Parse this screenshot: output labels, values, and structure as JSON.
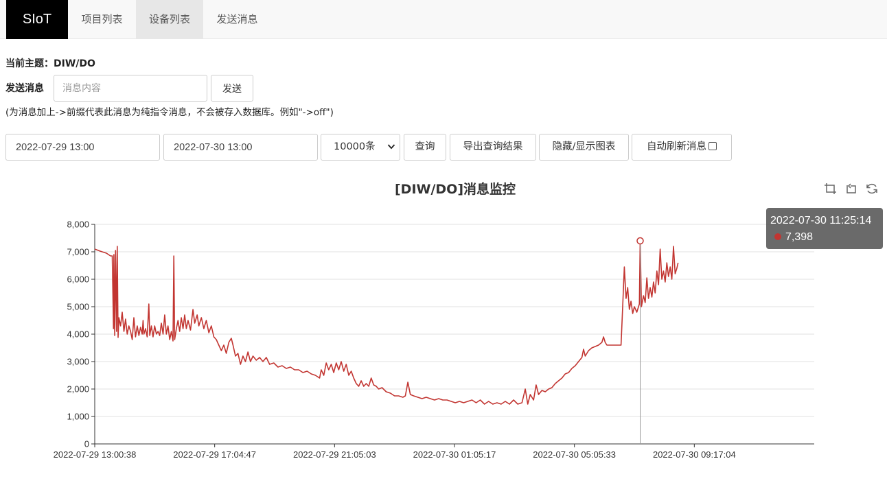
{
  "nav": {
    "brand": "SIoT",
    "items": [
      "项目列表",
      "设备列表",
      "发送消息"
    ]
  },
  "topic": {
    "label": "当前主题：DIW/DO"
  },
  "send": {
    "label": "发送消息",
    "placeholder": "消息内容",
    "button": "发送",
    "hint": "(为消息加上->前缀代表此消息为纯指令消息，不会被存入数据库。例如\"->off\")"
  },
  "query": {
    "start": "2022-07-29 13:00",
    "end": "2022-07-30 13:00",
    "limit": "10000条",
    "search_button": "查询",
    "export_button": "导出查询结果",
    "toggle_chart_button": "隐藏/显示图表",
    "auto_refresh_label": "自动刷新消息"
  },
  "colors": {
    "series": "#c23531",
    "brand_bg": "#000000",
    "tooltip_bg": "#505050"
  },
  "tooltip": {
    "time": "2022-07-30 11:25:14",
    "value": "7,398"
  },
  "toolbox": [
    "zoom-icon",
    "zoom-reset-icon",
    "restore-icon"
  ],
  "chart_data": {
    "type": "line",
    "title": "[DIW/DO]消息监控",
    "xlabel": "",
    "ylabel": "",
    "x_range": [
      0,
      86400
    ],
    "ylim": [
      0,
      8000
    ],
    "yticks": [
      0,
      1000,
      2000,
      3000,
      4000,
      5000,
      6000,
      7000,
      8000
    ],
    "ytick_labels": [
      "0",
      "1,000",
      "2,000",
      "3,000",
      "4,000",
      "5,000",
      "6,000",
      "7,000",
      "8,000"
    ],
    "xtick_labels": [
      {
        "t": 0,
        "label": "2022-07-29 13:00:38"
      },
      {
        "t": 14400,
        "label": "2022-07-29 17:04:47"
      },
      {
        "t": 28800,
        "label": "2022-07-29 21:05:03"
      },
      {
        "t": 43200,
        "label": "2022-07-30 01:05:17"
      },
      {
        "t": 57600,
        "label": "2022-07-30 05:05:33"
      },
      {
        "t": 72000,
        "label": "2022-07-30 09:17:04"
      }
    ],
    "grid": true,
    "series": [
      {
        "points": [
          [
            0,
            7100
          ],
          [
            700,
            7020
          ],
          [
            1400,
            6950
          ],
          [
            1900,
            6850
          ],
          [
            2100,
            6850
          ],
          [
            2250,
            4200
          ],
          [
            2300,
            6900
          ],
          [
            2400,
            3950
          ],
          [
            2500,
            7050
          ],
          [
            2620,
            4100
          ],
          [
            2700,
            7200
          ],
          [
            2800,
            3880
          ],
          [
            2900,
            4600
          ],
          [
            3100,
            4300
          ],
          [
            3300,
            4800
          ],
          [
            3500,
            4100
          ],
          [
            3700,
            4550
          ],
          [
            3900,
            4000
          ],
          [
            4100,
            4300
          ],
          [
            4300,
            4100
          ],
          [
            4500,
            3800
          ],
          [
            4700,
            4600
          ],
          [
            4900,
            3900
          ],
          [
            5100,
            4300
          ],
          [
            5300,
            3950
          ],
          [
            5500,
            4250
          ],
          [
            5700,
            4000
          ],
          [
            5800,
            4500
          ],
          [
            5900,
            4000
          ],
          [
            6100,
            4200
          ],
          [
            6300,
            3900
          ],
          [
            6500,
            5100
          ],
          [
            6600,
            3950
          ],
          [
            6800,
            4300
          ],
          [
            7000,
            3900
          ],
          [
            7200,
            4300
          ],
          [
            7400,
            4000
          ],
          [
            7600,
            4100
          ],
          [
            7800,
            3950
          ],
          [
            8000,
            4400
          ],
          [
            8200,
            4000
          ],
          [
            8400,
            4700
          ],
          [
            8600,
            4000
          ],
          [
            8800,
            4300
          ],
          [
            9000,
            3800
          ],
          [
            9200,
            4100
          ],
          [
            9400,
            3750
          ],
          [
            9500,
            6850
          ],
          [
            9600,
            3800
          ],
          [
            9800,
            4200
          ],
          [
            10000,
            4500
          ],
          [
            10200,
            4100
          ],
          [
            10400,
            4600
          ],
          [
            10600,
            4200
          ],
          [
            10800,
            4700
          ],
          [
            11000,
            4200
          ],
          [
            11200,
            4500
          ],
          [
            11500,
            4150
          ],
          [
            11800,
            4900
          ],
          [
            12000,
            4400
          ],
          [
            12300,
            4700
          ],
          [
            12500,
            4300
          ],
          [
            12800,
            4600
          ],
          [
            13100,
            4200
          ],
          [
            13400,
            4500
          ],
          [
            13700,
            4050
          ],
          [
            14000,
            4300
          ],
          [
            14300,
            3900
          ],
          [
            14600,
            3800
          ],
          [
            14900,
            3600
          ],
          [
            15200,
            3400
          ],
          [
            15500,
            3600
          ],
          [
            15800,
            3300
          ],
          [
            16100,
            3700
          ],
          [
            16400,
            3850
          ],
          [
            16600,
            3600
          ],
          [
            16900,
            3200
          ],
          [
            17200,
            3300
          ],
          [
            17500,
            2900
          ],
          [
            17800,
            3200
          ],
          [
            18100,
            3000
          ],
          [
            18400,
            3350
          ],
          [
            18700,
            3000
          ],
          [
            19000,
            3200
          ],
          [
            19400,
            3050
          ],
          [
            19800,
            3150
          ],
          [
            20200,
            3000
          ],
          [
            20600,
            3150
          ],
          [
            21000,
            2900
          ],
          [
            21500,
            2950
          ],
          [
            22000,
            2800
          ],
          [
            22500,
            2850
          ],
          [
            23000,
            2750
          ],
          [
            23500,
            2800
          ],
          [
            24000,
            2700
          ],
          [
            24500,
            2700
          ],
          [
            25000,
            2600
          ],
          [
            25500,
            2650
          ],
          [
            26000,
            2550
          ],
          [
            26500,
            2500
          ],
          [
            27000,
            2400
          ],
          [
            27200,
            2700
          ],
          [
            27500,
            2500
          ],
          [
            27800,
            2950
          ],
          [
            28100,
            2700
          ],
          [
            28400,
            2900
          ],
          [
            28700,
            2600
          ],
          [
            29000,
            2950
          ],
          [
            29300,
            2700
          ],
          [
            29600,
            3000
          ],
          [
            29900,
            2650
          ],
          [
            30200,
            2900
          ],
          [
            30500,
            2500
          ],
          [
            30800,
            2650
          ],
          [
            31100,
            2400
          ],
          [
            31400,
            2200
          ],
          [
            31700,
            2100
          ],
          [
            32000,
            2300
          ],
          [
            32300,
            2100
          ],
          [
            32600,
            2200
          ],
          [
            32900,
            2100
          ],
          [
            33200,
            2400
          ],
          [
            33500,
            2150
          ],
          [
            33800,
            2100
          ],
          [
            34100,
            2000
          ],
          [
            34500,
            2050
          ],
          [
            35000,
            1900
          ],
          [
            35500,
            1850
          ],
          [
            36000,
            1750
          ],
          [
            36500,
            1750
          ],
          [
            37000,
            1700
          ],
          [
            37300,
            1750
          ],
          [
            37600,
            2250
          ],
          [
            37900,
            1800
          ],
          [
            38300,
            1750
          ],
          [
            38800,
            1700
          ],
          [
            39300,
            1650
          ],
          [
            39800,
            1700
          ],
          [
            40300,
            1650
          ],
          [
            40800,
            1600
          ],
          [
            41300,
            1650
          ],
          [
            41800,
            1600
          ],
          [
            42300,
            1600
          ],
          [
            42800,
            1550
          ],
          [
            43300,
            1500
          ],
          [
            43800,
            1550
          ],
          [
            44300,
            1500
          ],
          [
            44800,
            1550
          ],
          [
            45300,
            1600
          ],
          [
            45800,
            1500
          ],
          [
            46300,
            1600
          ],
          [
            46800,
            1450
          ],
          [
            47300,
            1550
          ],
          [
            47800,
            1450
          ],
          [
            48300,
            1500
          ],
          [
            48800,
            1450
          ],
          [
            49300,
            1550
          ],
          [
            49800,
            1450
          ],
          [
            50300,
            1600
          ],
          [
            50800,
            1450
          ],
          [
            51300,
            1500
          ],
          [
            51700,
            2000
          ],
          [
            52000,
            1450
          ],
          [
            52300,
            1800
          ],
          [
            52700,
            1600
          ],
          [
            53000,
            2150
          ],
          [
            53300,
            1800
          ],
          [
            53700,
            1950
          ],
          [
            54100,
            1900
          ],
          [
            54500,
            2000
          ],
          [
            54900,
            2050
          ],
          [
            55300,
            2200
          ],
          [
            55700,
            2300
          ],
          [
            56100,
            2400
          ],
          [
            56500,
            2550
          ],
          [
            56900,
            2600
          ],
          [
            57300,
            2750
          ],
          [
            57700,
            2850
          ],
          [
            58100,
            3000
          ],
          [
            58500,
            3150
          ],
          [
            58700,
            3450
          ],
          [
            58900,
            3200
          ],
          [
            59300,
            3400
          ],
          [
            59700,
            3500
          ],
          [
            60100,
            3550
          ],
          [
            60500,
            3600
          ],
          [
            60900,
            3700
          ],
          [
            61100,
            3900
          ],
          [
            61300,
            3700
          ],
          [
            61500,
            3600
          ],
          [
            63200,
            3600
          ],
          [
            63400,
            5000
          ],
          [
            63600,
            6450
          ],
          [
            63800,
            5300
          ],
          [
            64000,
            5700
          ],
          [
            64200,
            4900
          ],
          [
            64400,
            5200
          ],
          [
            64600,
            4750
          ],
          [
            64800,
            5000
          ],
          [
            65100,
            4800
          ],
          [
            65400,
            5100
          ],
          [
            65500,
            7400
          ],
          [
            65650,
            5000
          ],
          [
            65900,
            5400
          ],
          [
            66100,
            5150
          ],
          [
            66300,
            6050
          ],
          [
            66500,
            5300
          ],
          [
            66700,
            5700
          ],
          [
            66900,
            5350
          ],
          [
            67100,
            5900
          ],
          [
            67300,
            5500
          ],
          [
            67500,
            6300
          ],
          [
            67700,
            5800
          ],
          [
            67900,
            7100
          ],
          [
            68100,
            6000
          ],
          [
            68300,
            6300
          ],
          [
            68500,
            5900
          ],
          [
            68700,
            6600
          ],
          [
            68900,
            6100
          ],
          [
            69100,
            6450
          ],
          [
            69300,
            6000
          ],
          [
            69500,
            7200
          ],
          [
            69700,
            6200
          ],
          [
            69900,
            6400
          ],
          [
            70050,
            6600
          ]
        ]
      }
    ]
  }
}
